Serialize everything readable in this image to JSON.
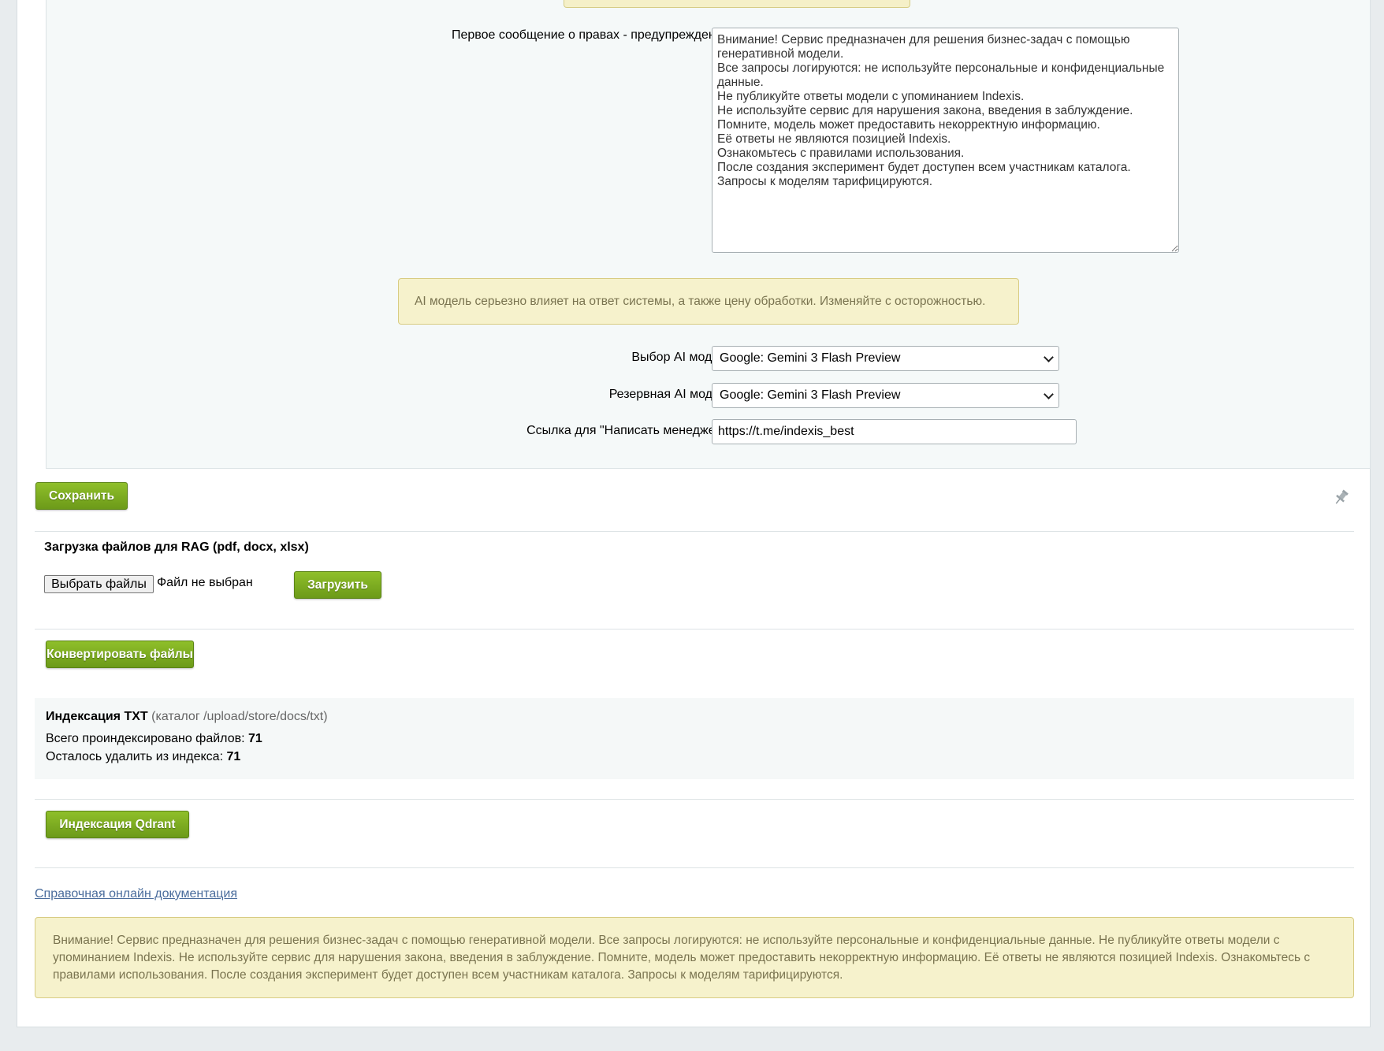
{
  "form": {
    "rights_label": "Первое сообщение о правах - предупреждение.",
    "rights_text": "Внимание! Сервис предназначен для решения бизнес-задач с помощью генеративной модели.\nВсе запросы логируются: не используйте персональные и конфиденциальные данные.\nНе публикуйте ответы модели с упоминанием Indexis.\nНе используйте сервис для нарушения закона, введения в заблуждение.\nПомните, модель может предоставить некорректную информацию.\nЕё ответы не являются позицией Indexis.\nОзнакомьтесь с правилами использования.\nПосле создания эксперимент будет доступен всем участникам каталога.\nЗапросы к моделям тарифицируются.",
    "model_warning": "AI модель серьезно влияет на ответ системы, а также цену обработки. Изменяйте с осторожностью.",
    "model_label": "Выбор AI модели",
    "model_value": "Google: Gemini 3 Flash Preview",
    "backup_model_label": "Резервная AI модель",
    "backup_model_value": "Google: Gemini 3 Flash Preview",
    "manager_link_label": "Ссылка для \"Написать менеджеру\"",
    "manager_link_value": "https://t.me/indexis_best"
  },
  "toolbar": {
    "save_label": "Сохранить",
    "pin_icon": "pin-icon"
  },
  "upload": {
    "title": "Загрузка файлов для RAG (pdf, docx, xlsx)",
    "choose_label": "Выбрать файлы",
    "status": "Файл не выбран",
    "upload_label": "Загрузить"
  },
  "convert": {
    "label": "Конвертировать файлы"
  },
  "index_txt": {
    "title": "Индексация TXT",
    "subtitle": "(каталог /upload/store/docs/txt)",
    "total_label": "Всего проиндексировано файлов:",
    "total_value": "71",
    "remaining_label": "Осталось удалить из индекса:",
    "remaining_value": "71"
  },
  "qdrant": {
    "label": "Индексация Qdrant"
  },
  "docs_link": "Справочная онлайн документация",
  "footer_warning": "Внимание! Сервис предназначен для решения бизнес-задач с помощью генеративной модели. Все запросы логируются: не используйте персональные и конфиденциальные данные. Не публикуйте ответы модели с упоминанием Indexis. Не используйте сервис для нарушения закона, введения в заблуждение. Помните, модель может предоставить некорректную информацию. Её ответы не являются позицией Indexis. Ознакомьтесь с правилами использования. После создания эксперимент будет доступен всем участникам каталога. Запросы к моделям тарифицируются.",
  "colors": {
    "accent_green": "#7aaa20",
    "warning_bg": "#f6f2cc",
    "link": "#4a6c9c"
  }
}
